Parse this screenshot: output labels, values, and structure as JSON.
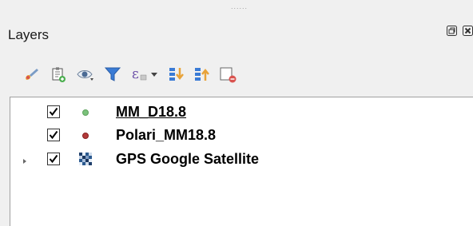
{
  "panel": {
    "title": "Layers",
    "grip": "......",
    "buttons": {
      "float": "float-panel-icon",
      "close": "close-panel-icon"
    }
  },
  "toolbar": {
    "tools": [
      {
        "name": "style-manager-icon"
      },
      {
        "name": "add-group-icon"
      },
      {
        "name": "manage-visibility-icon"
      },
      {
        "name": "filter-legend-icon"
      },
      {
        "name": "filter-by-expression-icon"
      },
      {
        "name": "dropdown-arrow-icon"
      },
      {
        "name": "expand-all-icon"
      },
      {
        "name": "collapse-all-icon"
      },
      {
        "name": "remove-layer-icon"
      }
    ]
  },
  "layers": [
    {
      "label": "MM_D18.8",
      "checked": true,
      "symbol": "point",
      "color": "#7bc27b",
      "active": true,
      "expandable": false
    },
    {
      "label": "Polari_MM18.8",
      "checked": true,
      "symbol": "point",
      "color": "#b23a3a",
      "active": false,
      "expandable": false
    },
    {
      "label": "GPS Google Satellite",
      "checked": true,
      "symbol": "raster",
      "active": false,
      "expandable": true
    }
  ],
  "colors": {
    "background": "#f0f0f0",
    "tree_background": "#ffffff"
  }
}
